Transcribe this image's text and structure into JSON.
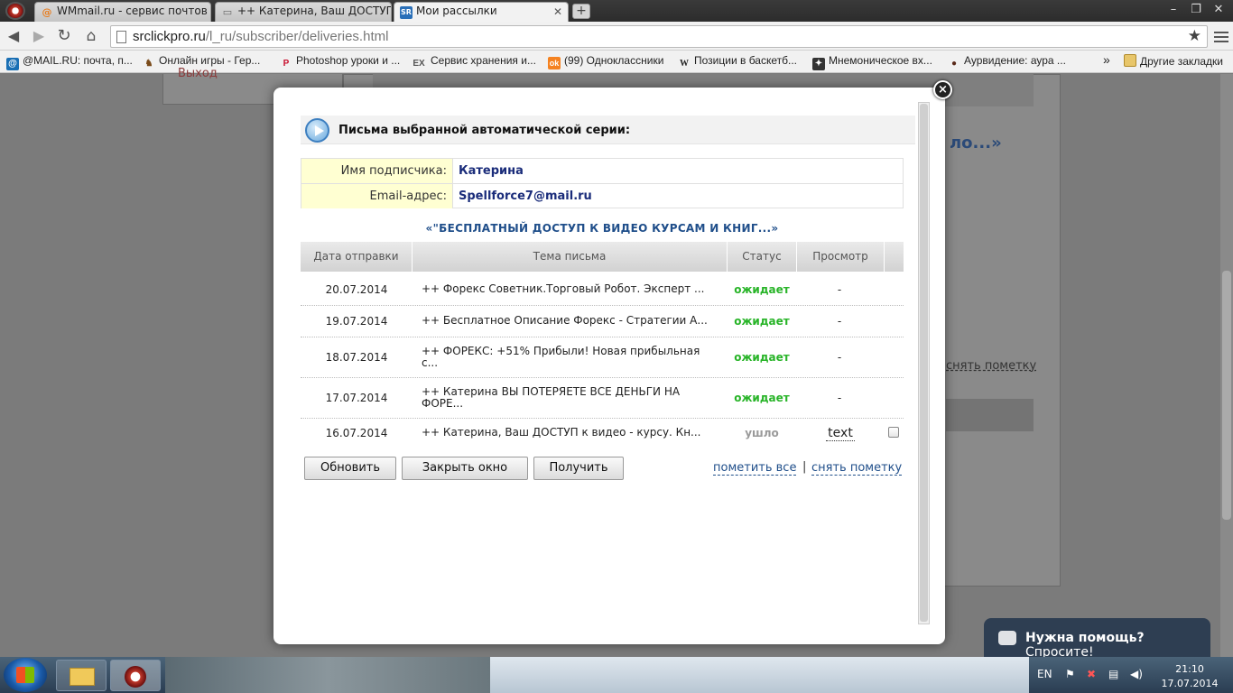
{
  "browser": {
    "tabs": [
      {
        "icon": "@",
        "title": "WMmail.ru - сервис почтов"
      },
      {
        "icon": "▭",
        "title": "++ Катерина, Ваш ДОСТУП"
      },
      {
        "icon": "SR",
        "title": "Мои рассылки"
      }
    ],
    "url_host": "srclickpro.ru",
    "url_path": "/l_ru/subscriber/deliveries.html",
    "bookmarks": [
      {
        "label": "@MAIL.RU: почта, п...",
        "icon": "@",
        "color": "#1a6fb4"
      },
      {
        "label": "Онлайн игры - Гер...",
        "icon": "♞",
        "color": "#7a4b1a"
      },
      {
        "label": "Photoshop уроки и ...",
        "icon": "P",
        "color": "#c8102e"
      },
      {
        "label": "Сервис хранения и...",
        "icon": "EX",
        "color": "#555"
      },
      {
        "label": "(99) Одноклассники",
        "icon": "ok",
        "color": "#f58220"
      },
      {
        "label": "Позиции в баскетб...",
        "icon": "W",
        "color": "#222"
      },
      {
        "label": "Мнемоническое вх...",
        "icon": "✦",
        "color": "#333"
      },
      {
        "label": "Аурвидение: аура ...",
        "icon": "●",
        "color": "#5a2a1a"
      }
    ],
    "bookmarks_more": "»",
    "other_bookmarks": "Другие закладки"
  },
  "background": {
    "exit_link": "Выход",
    "heading_fragment": "ло...»",
    "unmark_fragment": "снять пометку"
  },
  "modal": {
    "title": "Письма выбранной автоматической серии:",
    "subscriber_label": "Имя подписчика:",
    "subscriber_name": "Катерина",
    "email_label": "Email-адрес:",
    "email": "Spellforce7@mail.ru",
    "series_title": "«\"БЕСПЛАТНЫЙ ДОСТУП К ВИДЕО КУРСАМ И КНИГ...»",
    "columns": [
      "Дата отправки",
      "Тема письма",
      "Статус",
      "Просмотр"
    ],
    "rows": [
      {
        "date": "20.07.2014",
        "subject": "++ Форекс Советник.Торговый Робот. Эксперт ...",
        "status": "ожидает",
        "view": "-"
      },
      {
        "date": "19.07.2014",
        "subject": "++ Бесплатное Описание Форекс - Стратегии А...",
        "status": "ожидает",
        "view": "-"
      },
      {
        "date": "18.07.2014",
        "subject": "++ ФОРЕКС: +51% Прибыли! Новая прибыльная с...",
        "status": "ожидает",
        "view": "-"
      },
      {
        "date": "17.07.2014",
        "subject": "++ Катерина ВЫ ПОТЕРЯЕТЕ ВСЕ ДЕНЬГИ НА ФОРЕ...",
        "status": "ожидает",
        "view": "-"
      },
      {
        "date": "16.07.2014",
        "subject": "++ Катерина, Ваш ДОСТУП к видео - курсу. Кн...",
        "status": "ушло",
        "view": "text"
      }
    ],
    "buttons": {
      "refresh": "Обновить",
      "close": "Закрыть окно",
      "get": "Получить"
    },
    "mark_all": "пометить все",
    "separator": "|",
    "unmark": "снять пометку",
    "close_icon": "×"
  },
  "help_widget": {
    "bold": "Нужна помощь?",
    "text": " Спросите!"
  },
  "taskbar": {
    "lang": "EN",
    "time": "21:10",
    "date": "17.07.2014"
  }
}
